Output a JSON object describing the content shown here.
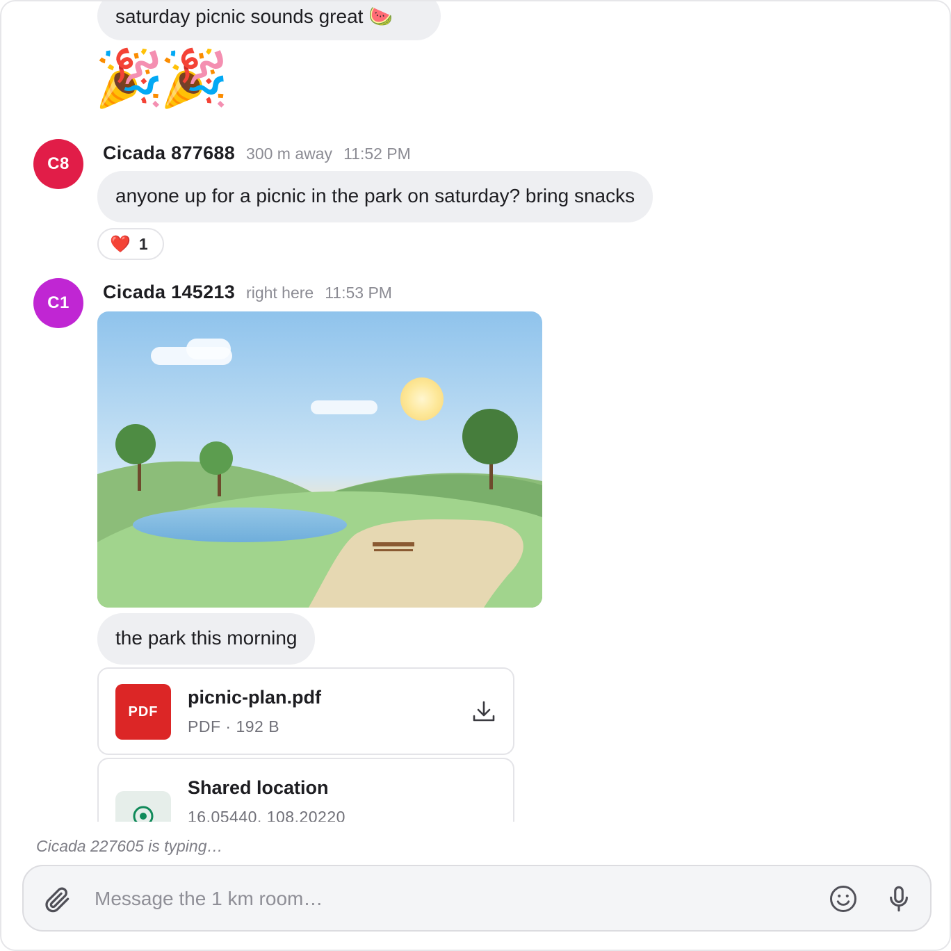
{
  "messages": [
    {
      "partial_text": "saturday picnic sounds great 🍉",
      "emoji": "🎉🎉"
    },
    {
      "avatar": "C8",
      "avatar_color": "#e11d48",
      "sender": "Cicada 877688",
      "distance": "300 m away",
      "time": "11:52 PM",
      "text": "anyone up for a picnic in the park on saturday? bring snacks",
      "reaction": {
        "emoji": "❤️",
        "count": "1"
      }
    },
    {
      "avatar": "C1",
      "avatar_color": "#c026d3",
      "sender": "Cicada 145213",
      "distance": "right here",
      "time": "11:53 PM",
      "caption": "the park this morning",
      "attachment": {
        "badge": "PDF",
        "name": "picnic-plan.pdf",
        "meta": "PDF · 192 B"
      },
      "location": {
        "title": "Shared location",
        "coords": "16.05440, 108.20220"
      }
    }
  ],
  "typing_indicator": "Cicada 227605 is typing…",
  "composer": {
    "placeholder": "Message the 1 km room…"
  },
  "icons": [
    "paperclip-icon",
    "smiley-icon",
    "microphone-icon",
    "download-icon",
    "location-pin-icon"
  ]
}
